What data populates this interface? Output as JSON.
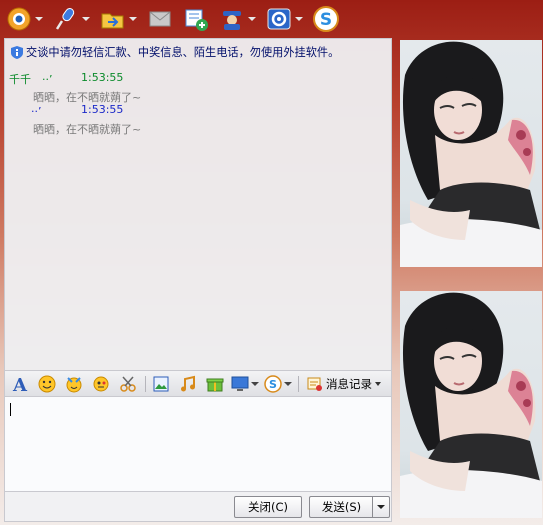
{
  "toolbar": {
    "items": [
      {
        "icon": "webcam-icon",
        "has_dropdown": true
      },
      {
        "icon": "microphone-icon",
        "has_dropdown": true
      },
      {
        "icon": "folder-send-icon",
        "has_dropdown": true
      },
      {
        "icon": "email-icon",
        "has_dropdown": false
      },
      {
        "icon": "add-app-icon",
        "has_dropdown": false
      },
      {
        "icon": "agent-icon",
        "has_dropdown": true
      },
      {
        "icon": "settings-icon",
        "has_dropdown": true
      },
      {
        "icon": "soso-icon",
        "has_dropdown": false
      }
    ]
  },
  "chat": {
    "notice": "交谈中请勿轻信汇款、中奖信息、陌生电话，勿使用外挂软件。",
    "messages": [
      {
        "sender": "千千　··’",
        "time": "1:53:55",
        "text": "晒晒，在不晒就蒴了~",
        "color": "#0a8a2a"
      },
      {
        "sender": "　　··’",
        "time": "1:53:55",
        "text": "晒晒，在不晒就蒴了~",
        "color": "#1a28c8"
      }
    ]
  },
  "format_bar": {
    "history_label": "消息记录"
  },
  "input": {
    "value": ""
  },
  "buttons": {
    "close_label": "关闭(C)",
    "send_label": "发送(S)"
  },
  "colors": {
    "accent": "#1a28c8",
    "sender_green": "#0a8a2a",
    "notice": "#000e6a"
  }
}
